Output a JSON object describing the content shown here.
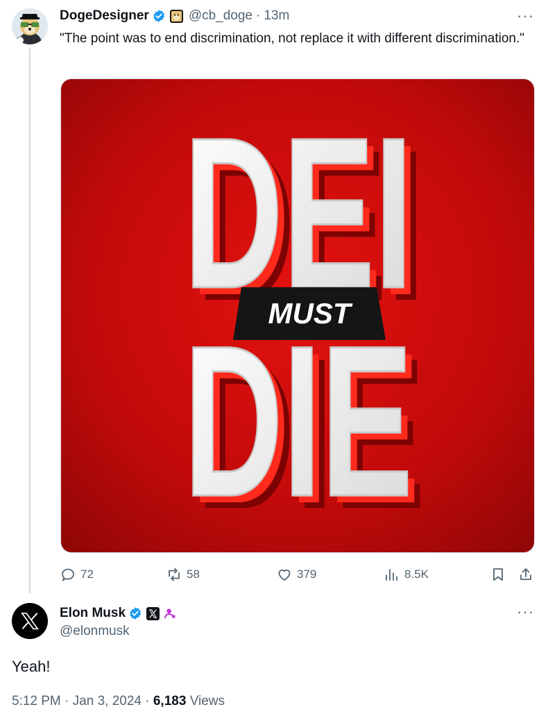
{
  "tweet1": {
    "display_name": "DogeDesigner",
    "handle": "@cb_doge",
    "separator": "·",
    "time": "13m",
    "text": "\"The point was to end discrimination, not replace it with different discrimination.\"",
    "more": "···",
    "image": {
      "line1": "DEI",
      "banner": "MUST",
      "line2": "DIE",
      "bg_color": "#c40a0a"
    },
    "stats": {
      "replies": "72",
      "reposts": "58",
      "likes": "379",
      "views": "8.5K"
    }
  },
  "tweet2": {
    "display_name": "Elon Musk",
    "handle": "@elonmusk",
    "more": "···",
    "text": "Yeah!",
    "time": "5:12 PM",
    "date": "Jan 3, 2024",
    "separator": "·",
    "views_count": "6,183",
    "views_label": "Views"
  },
  "colors": {
    "verified_blue": "#1d9bf0",
    "muted": "#536471",
    "thread_line": "#cfd9de"
  }
}
